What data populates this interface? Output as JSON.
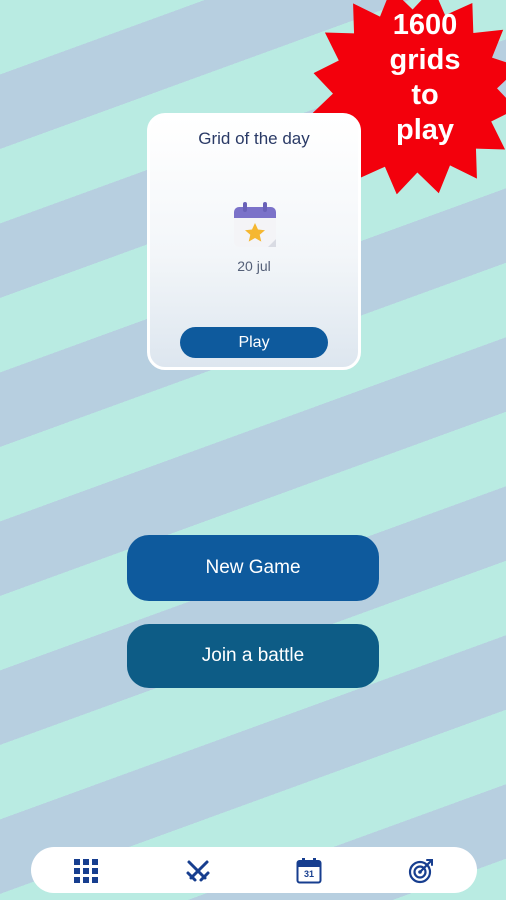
{
  "promo": {
    "lines": [
      "1600",
      "grids",
      "to",
      "play"
    ]
  },
  "daily": {
    "title": "Grid of the day",
    "date": "20 jul",
    "play_label": "Play",
    "icon": "calendar-star-icon"
  },
  "actions": {
    "new_game": "New Game",
    "join_battle": "Join a battle"
  },
  "bottom_nav": {
    "items": [
      {
        "icon": "grid-icon"
      },
      {
        "icon": "crossed-swords-icon"
      },
      {
        "icon": "calendar-icon",
        "label": "31"
      },
      {
        "icon": "target-icon"
      }
    ]
  },
  "colors": {
    "primary": "#0e5a9d",
    "secondary": "#0d5c86",
    "promo_red": "#f3000c",
    "stripe_a": "#b9ebe2",
    "stripe_b": "#b7cfe0"
  }
}
